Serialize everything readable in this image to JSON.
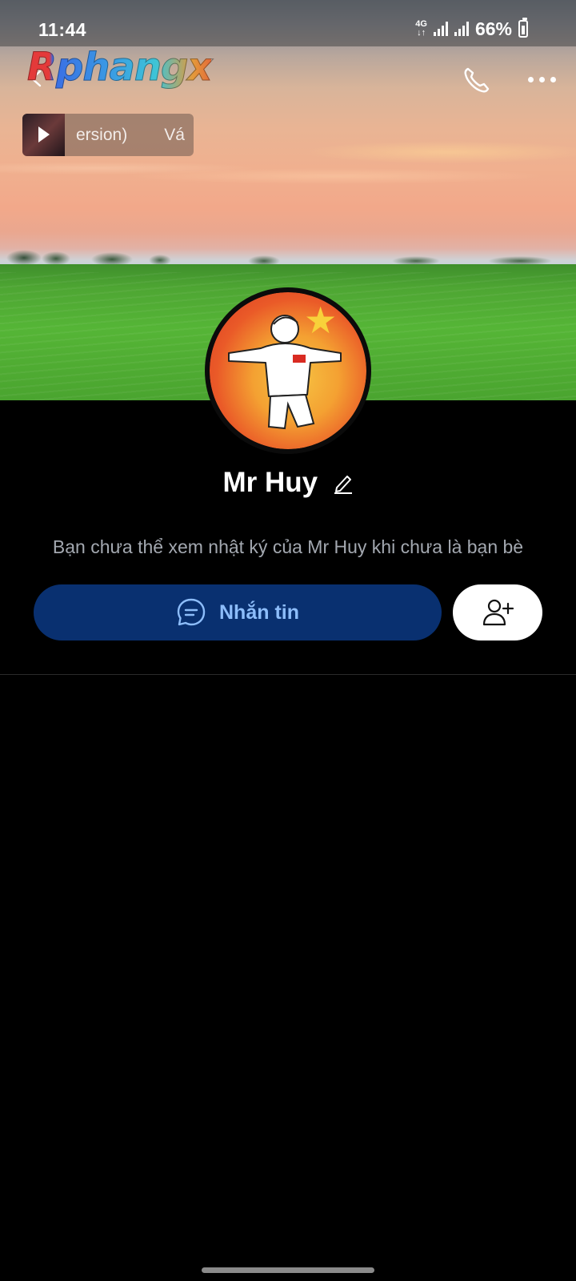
{
  "status_bar": {
    "time": "11:44",
    "network_type": "4G",
    "battery_percent": "66%"
  },
  "header": {
    "logo_text": "Rphangx",
    "icons": [
      "back-icon",
      "phone-icon",
      "more-icon"
    ]
  },
  "music": {
    "title_fragment": "ersion)",
    "artist_fragment": "Vá"
  },
  "profile": {
    "name": "Mr Huy",
    "notice": "Bạn chưa thể xem nhật ký của Mr Huy khi chưa là bạn bè"
  },
  "actions": {
    "message_label": "Nhắn tin"
  },
  "colors": {
    "background": "#000000",
    "message_button": "#093070",
    "message_label": "#8dbdfa",
    "add_button": "#ffffff",
    "notice_text": "#a3a8b0"
  }
}
